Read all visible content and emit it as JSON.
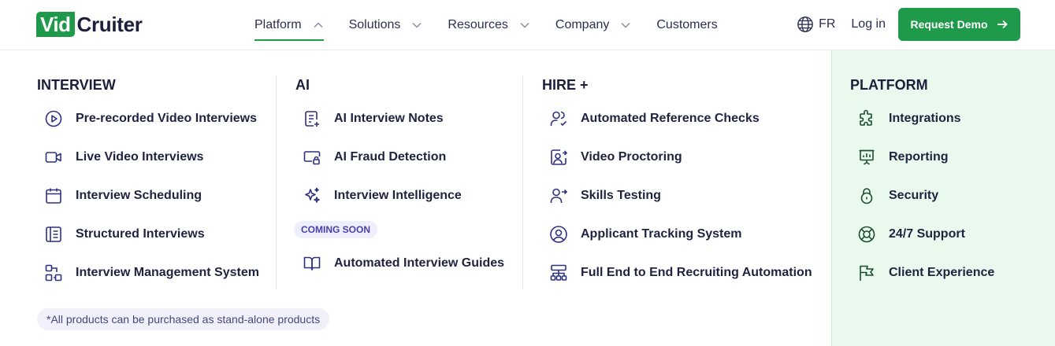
{
  "brand": {
    "logo_part1": "Vid",
    "logo_part2": "Cruiter",
    "accent": "#1f9a4a",
    "icon_color": "#2e3180"
  },
  "nav": {
    "items": [
      {
        "label": "Platform",
        "has_chevron": true,
        "active": true
      },
      {
        "label": "Solutions",
        "has_chevron": true
      },
      {
        "label": "Resources",
        "has_chevron": true
      },
      {
        "label": "Company",
        "has_chevron": true
      },
      {
        "label": "Customers",
        "has_chevron": false
      }
    ],
    "language": "FR",
    "login": "Log in",
    "demo_button": "Request Demo"
  },
  "menu": {
    "interview": {
      "title": "INTERVIEW",
      "items": [
        {
          "label": "Pre-recorded Video Interviews",
          "icon": "play-circle-icon"
        },
        {
          "label": "Live Video Interviews",
          "icon": "video-camera-icon"
        },
        {
          "label": "Interview Scheduling",
          "icon": "calendar-icon"
        },
        {
          "label": "Structured Interviews",
          "icon": "book-list-icon"
        },
        {
          "label": "Interview Management System",
          "icon": "workflow-icon"
        }
      ]
    },
    "ai": {
      "title": "AI",
      "items": [
        {
          "label": "AI Interview Notes",
          "icon": "note-plus-icon"
        },
        {
          "label": "AI Fraud Detection",
          "icon": "screen-lock-icon"
        },
        {
          "label": "Interview Intelligence",
          "icon": "sparkles-icon"
        },
        {
          "label": "Automated Interview Guides",
          "icon": "open-book-icon"
        }
      ],
      "badge": "COMING SOON"
    },
    "hire": {
      "title": "HIRE +",
      "items": [
        {
          "label": "Automated Reference Checks",
          "icon": "user-check-icon"
        },
        {
          "label": "Video Proctoring",
          "icon": "user-screen-icon"
        },
        {
          "label": "Skills Testing",
          "icon": "user-arrow-icon"
        },
        {
          "label": "Applicant Tracking System",
          "icon": "user-circle-icon"
        },
        {
          "label": "Full End to End Recruiting Automation",
          "icon": "hierarchy-icon"
        }
      ]
    },
    "platform": {
      "title": "PLATFORM",
      "items": [
        {
          "label": "Integrations",
          "icon": "puzzle-icon"
        },
        {
          "label": "Reporting",
          "icon": "presentation-chart-icon"
        },
        {
          "label": "Security",
          "icon": "padlock-icon"
        },
        {
          "label": "24/7 Support",
          "icon": "lifebuoy-icon"
        },
        {
          "label": "Client Experience",
          "icon": "flag-icon"
        }
      ]
    },
    "footnote": "*All products can be purchased as stand-alone products"
  }
}
